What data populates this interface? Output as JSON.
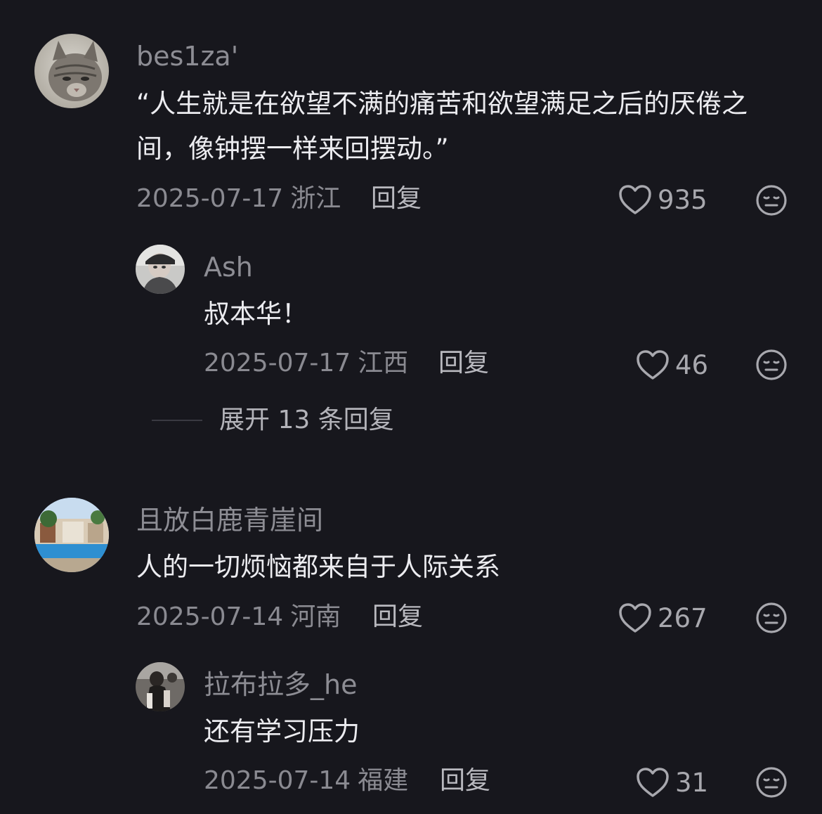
{
  "comments": [
    {
      "username": "bes1za'",
      "text": "“人生就是在欲望不满的痛苦和欲望满足之后的厌倦之间，像钟摆一样来回摆动。”",
      "date": "2025-07-17",
      "location": "浙江",
      "reply_label": "回复",
      "likes": "935",
      "avatar": "cat-avatar",
      "replies": [
        {
          "username": "Ash",
          "text": "叔本华！",
          "date": "2025-07-17",
          "location": "江西",
          "reply_label": "回复",
          "likes": "46",
          "avatar": "person-cap-avatar"
        }
      ],
      "expand_label": "展开 13 条回复"
    },
    {
      "username": "且放白鹿青崖间",
      "text": "人的一切烦恼都来自于人际关系",
      "date": "2025-07-14",
      "location": "河南",
      "reply_label": "回复",
      "likes": "267",
      "avatar": "resort-pool-avatar",
      "replies": [
        {
          "username": "拉布拉多_he",
          "text": "还有学习压力",
          "date": "2025-07-14",
          "location": "福建",
          "reply_label": "回复",
          "likes": "31",
          "avatar": "figure-avatar"
        }
      ]
    }
  ],
  "colors": {
    "background": "#17171d",
    "username": "#8d8d94",
    "text": "#ececf0",
    "meta": "#8a8a91",
    "icon": "#a8a8ae"
  }
}
